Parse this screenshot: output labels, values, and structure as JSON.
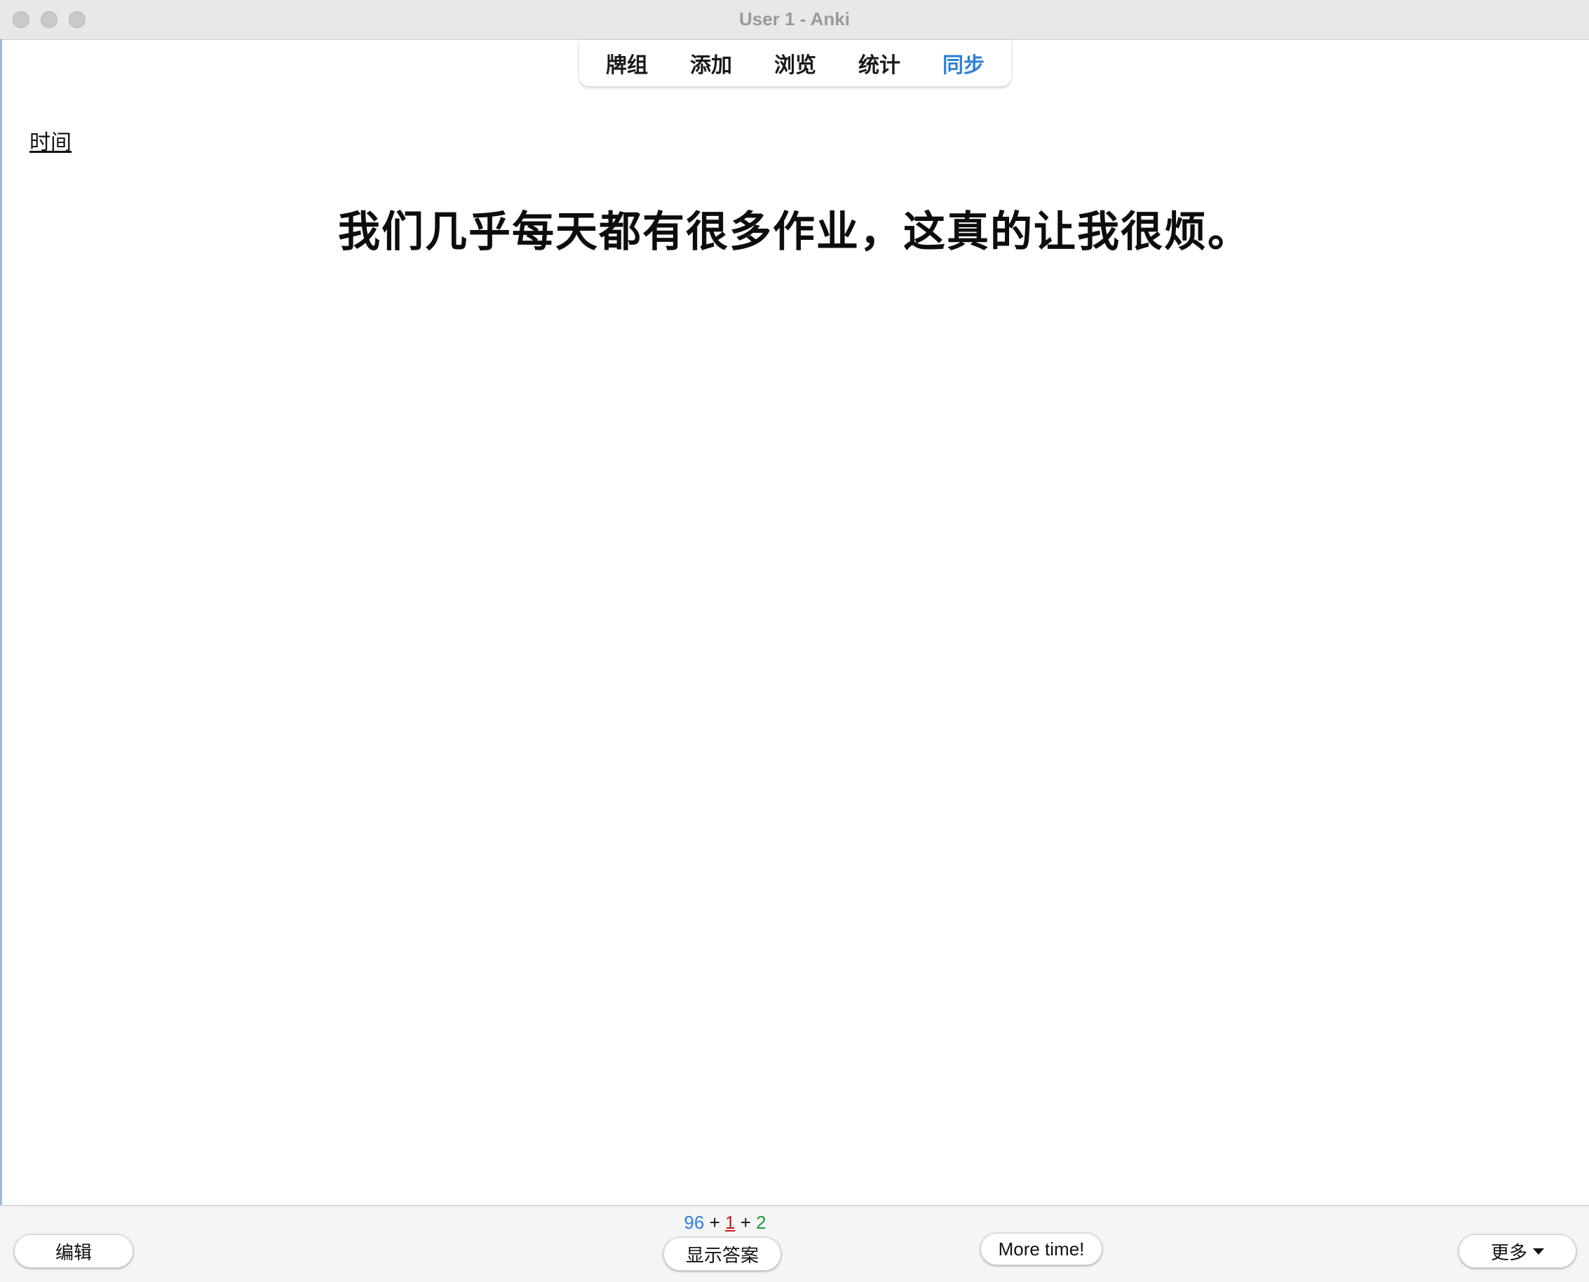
{
  "window": {
    "title": "User 1 - Anki"
  },
  "toolbar": {
    "items": [
      {
        "label": "牌组"
      },
      {
        "label": "添加"
      },
      {
        "label": "浏览"
      },
      {
        "label": "统计"
      },
      {
        "label": "同步",
        "active": true
      }
    ],
    "accent_color": "#2f7fd8"
  },
  "card": {
    "field_tag": "时间",
    "question": "我们几乎每天都有很多作业，这真的让我很烦。"
  },
  "bottom": {
    "edit_label": "编辑",
    "counts": {
      "new": "96",
      "sep1": "+",
      "learning": "1",
      "sep2": "+",
      "review": "2"
    },
    "count_colors": {
      "new": "#2f7fd8",
      "learning": "#c8171f",
      "review": "#1b9b3a"
    },
    "show_answer_label": "显示答案",
    "more_time_label": "More time!",
    "more_label": "更多"
  }
}
